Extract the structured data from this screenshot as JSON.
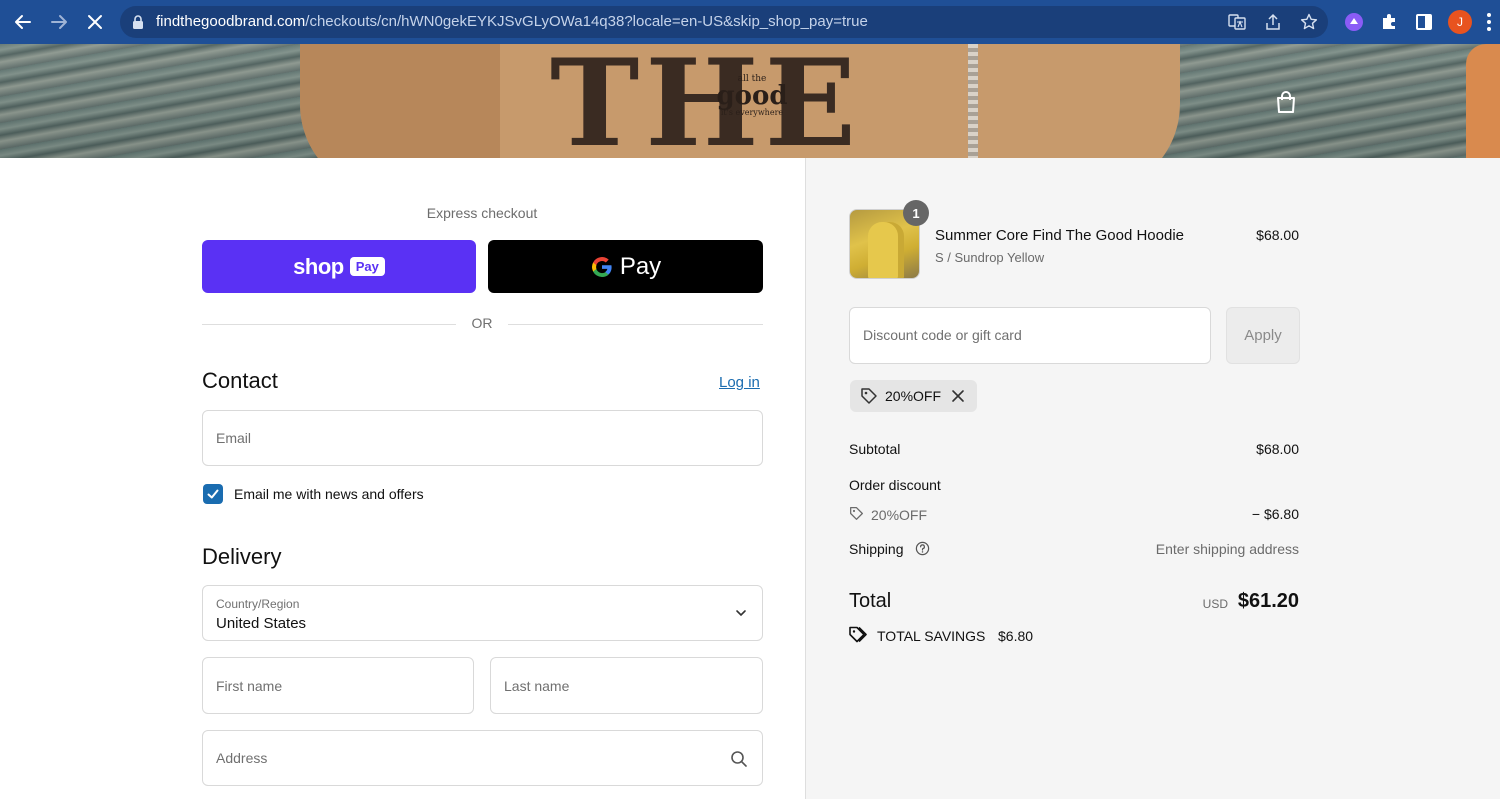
{
  "browser": {
    "url_domain": "findthegoodbrand.com",
    "url_path": "/checkouts/cn/hWN0gekEYKJSvGLyOWa14q38?locale=en-US&skip_shop_pay=true",
    "profile_initial": "J"
  },
  "banner": {
    "big_text": "THE",
    "logo_top": "all the",
    "logo_main": "good",
    "logo_bottom": "it's everywhere"
  },
  "express": {
    "title": "Express checkout",
    "shop_pay_word": "shop",
    "shop_pay_pill": "Pay",
    "gpay_g": "G",
    "gpay_word": "Pay",
    "or": "OR"
  },
  "contact": {
    "title": "Contact",
    "login": "Log in",
    "email_placeholder": "Email",
    "newsletter_label": "Email me with news and offers",
    "newsletter_checked": true
  },
  "delivery": {
    "title": "Delivery",
    "country_label": "Country/Region",
    "country_value": "United States",
    "first_name_placeholder": "First name",
    "last_name_placeholder": "Last name",
    "address_placeholder": "Address"
  },
  "order": {
    "item": {
      "name": "Summer Core Find The Good Hoodie",
      "variant": "S / Sundrop Yellow",
      "price": "$68.00",
      "quantity": "1"
    },
    "discount_placeholder": "Discount code or gift card",
    "apply": "Apply",
    "applied_code": "20%OFF",
    "subtotal_label": "Subtotal",
    "subtotal_value": "$68.00",
    "order_discount_label": "Order discount",
    "discount_code": "20%OFF",
    "discount_value": "− $6.80",
    "shipping_label": "Shipping",
    "shipping_value": "Enter shipping address",
    "total_label": "Total",
    "total_currency": "USD",
    "total_value": "$61.20",
    "savings_label": "TOTAL SAVINGS",
    "savings_value": "$6.80"
  },
  "colors": {
    "browser_bar": "#1f4f96",
    "shop_pay": "#5a31f4",
    "link": "#1a6cb0",
    "summary_bg": "#f5f5f5"
  }
}
